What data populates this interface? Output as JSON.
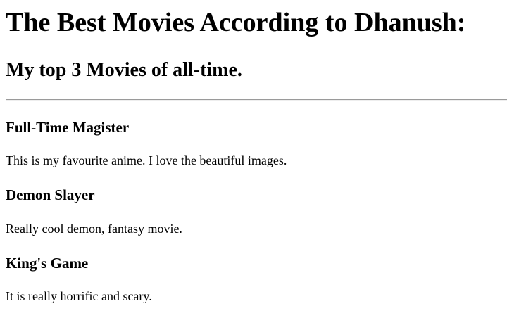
{
  "page": {
    "heading": "The Best Movies According to Dhanush:",
    "subheading": "My top 3 Movies of all-time."
  },
  "movies": [
    {
      "title": "Full-Time Magister",
      "description": "This is my favourite anime. I love the beautiful images."
    },
    {
      "title": "Demon Slayer",
      "description": "Really cool demon, fantasy movie."
    },
    {
      "title": "King's Game",
      "description": "It is really horrific and scary."
    }
  ]
}
